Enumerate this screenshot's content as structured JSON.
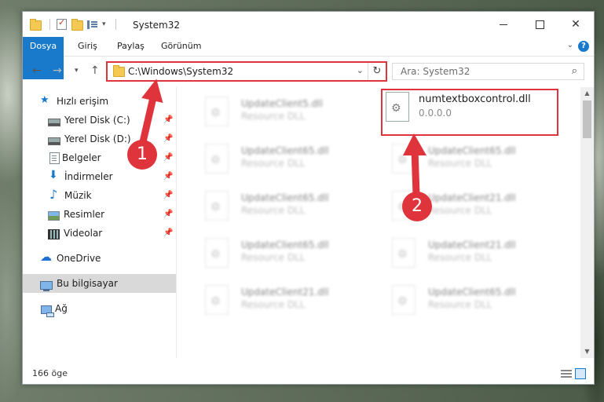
{
  "window": {
    "title": "System32"
  },
  "ribbon": {
    "tabs": [
      "Dosya",
      "Giriş",
      "Paylaş",
      "Görünüm"
    ],
    "help": "?"
  },
  "nav": {
    "address": "C:\\Windows\\System32",
    "search_placeholder": "Ara: System32"
  },
  "sidebar": {
    "items": [
      {
        "label": "Hızlı erişim",
        "icon": "star-icon"
      },
      {
        "label": "Yerel Disk (C:)",
        "icon": "disk-icon",
        "pinned": true
      },
      {
        "label": "Yerel Disk (D:)",
        "icon": "disk-icon",
        "pinned": true
      },
      {
        "label": "Belgeler",
        "icon": "documents-icon",
        "pinned": true
      },
      {
        "label": "İndirmeler",
        "icon": "download-icon",
        "pinned": true
      },
      {
        "label": "Müzik",
        "icon": "music-icon",
        "pinned": true
      },
      {
        "label": "Resimler",
        "icon": "pictures-icon",
        "pinned": true
      },
      {
        "label": "Videolar",
        "icon": "videos-icon",
        "pinned": true
      },
      {
        "label": "OneDrive",
        "icon": "onedrive-icon"
      },
      {
        "label": "Bu bilgisayar",
        "icon": "this-pc-icon",
        "selected": true
      },
      {
        "label": "Ağ",
        "icon": "network-icon"
      }
    ]
  },
  "files": {
    "highlighted": {
      "name": "numtextboxcontrol.dll",
      "desc": "0.0.0.0"
    },
    "left_column": [
      {
        "name": "UpdateClient5.dll",
        "desc": "Resource DLL"
      },
      {
        "name": "UpdateClient65.dll",
        "desc": "Resource DLL"
      },
      {
        "name": "UpdateClient65.dll",
        "desc": "Resource DLL"
      },
      {
        "name": "UpdateClient65.dll",
        "desc": "Resource DLL"
      },
      {
        "name": "UpdateClient21.dll",
        "desc": "Resource DLL"
      }
    ],
    "right_column": [
      {
        "name": "UpdateClient65.dll",
        "desc": "Resource DLL"
      },
      {
        "name": "UpdateClient21.dll",
        "desc": "Resource DLL"
      },
      {
        "name": "UpdateClient21.dll",
        "desc": "Resource DLL"
      },
      {
        "name": "UpdateClient65.dll",
        "desc": "Resource DLL"
      }
    ]
  },
  "status": {
    "count": "166 öge"
  },
  "callouts": {
    "one": "1",
    "two": "2",
    "color": "#e0343c"
  }
}
